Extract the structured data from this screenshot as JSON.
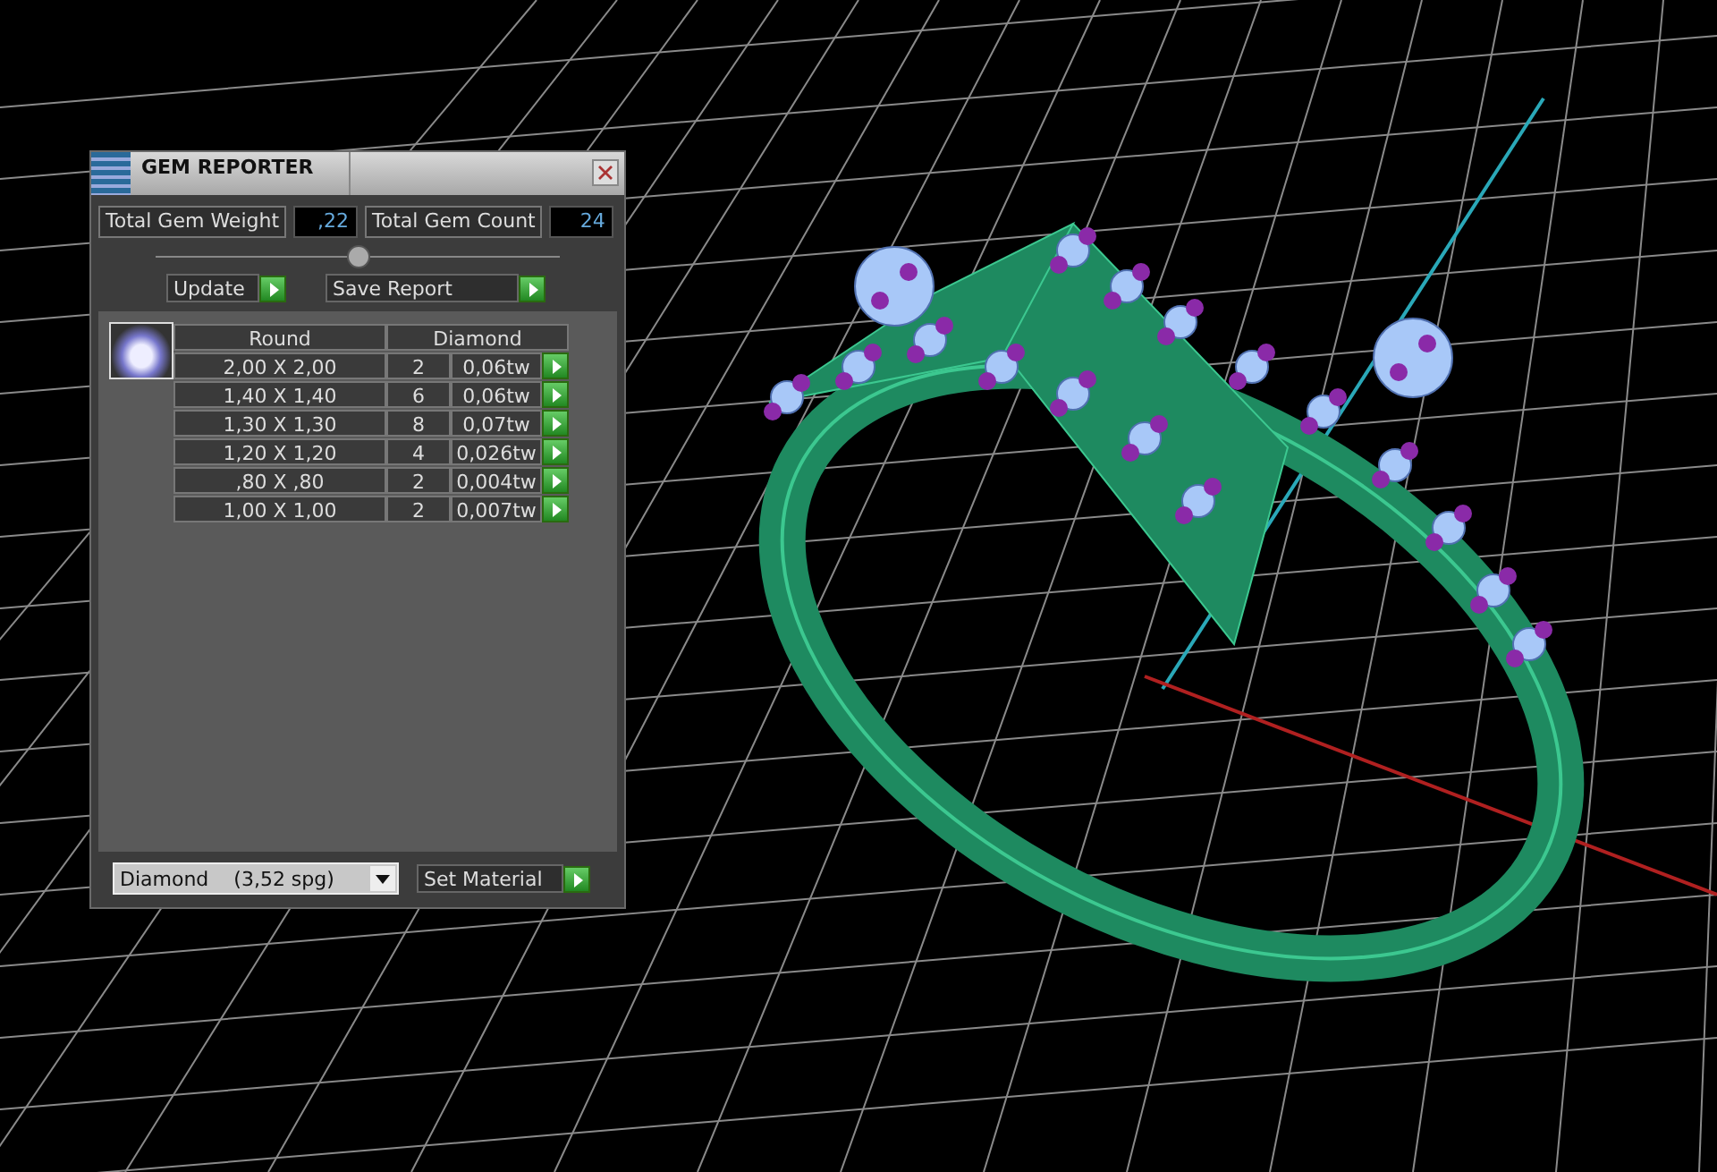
{
  "window": {
    "title": "GEM REPORTER"
  },
  "totals": [
    {
      "label": "Total Gem Weight",
      "value": ",22"
    },
    {
      "label": "Total Gem Count",
      "value": "24"
    }
  ],
  "buttons": [
    "Update",
    "Save Report"
  ],
  "gem_table": {
    "columns": [
      "Round",
      "Diamond"
    ],
    "rows": [
      {
        "size": "2,00 X 2,00",
        "count": "2",
        "weight": "0,06tw"
      },
      {
        "size": "1,40 X 1,40",
        "count": "6",
        "weight": "0,06tw"
      },
      {
        "size": "1,30 X 1,30",
        "count": "8",
        "weight": "0,07tw"
      },
      {
        "size": "1,20 X 1,20",
        "count": "4",
        "weight": "0,026tw"
      },
      {
        "size": ",80 X ,80",
        "count": "2",
        "weight": "0,004tw"
      },
      {
        "size": "1,00 X 1,00",
        "count": "2",
        "weight": "0,007tw"
      }
    ]
  },
  "material": {
    "value": "Diamond    (3,52 spg)",
    "button": "Set Material"
  }
}
